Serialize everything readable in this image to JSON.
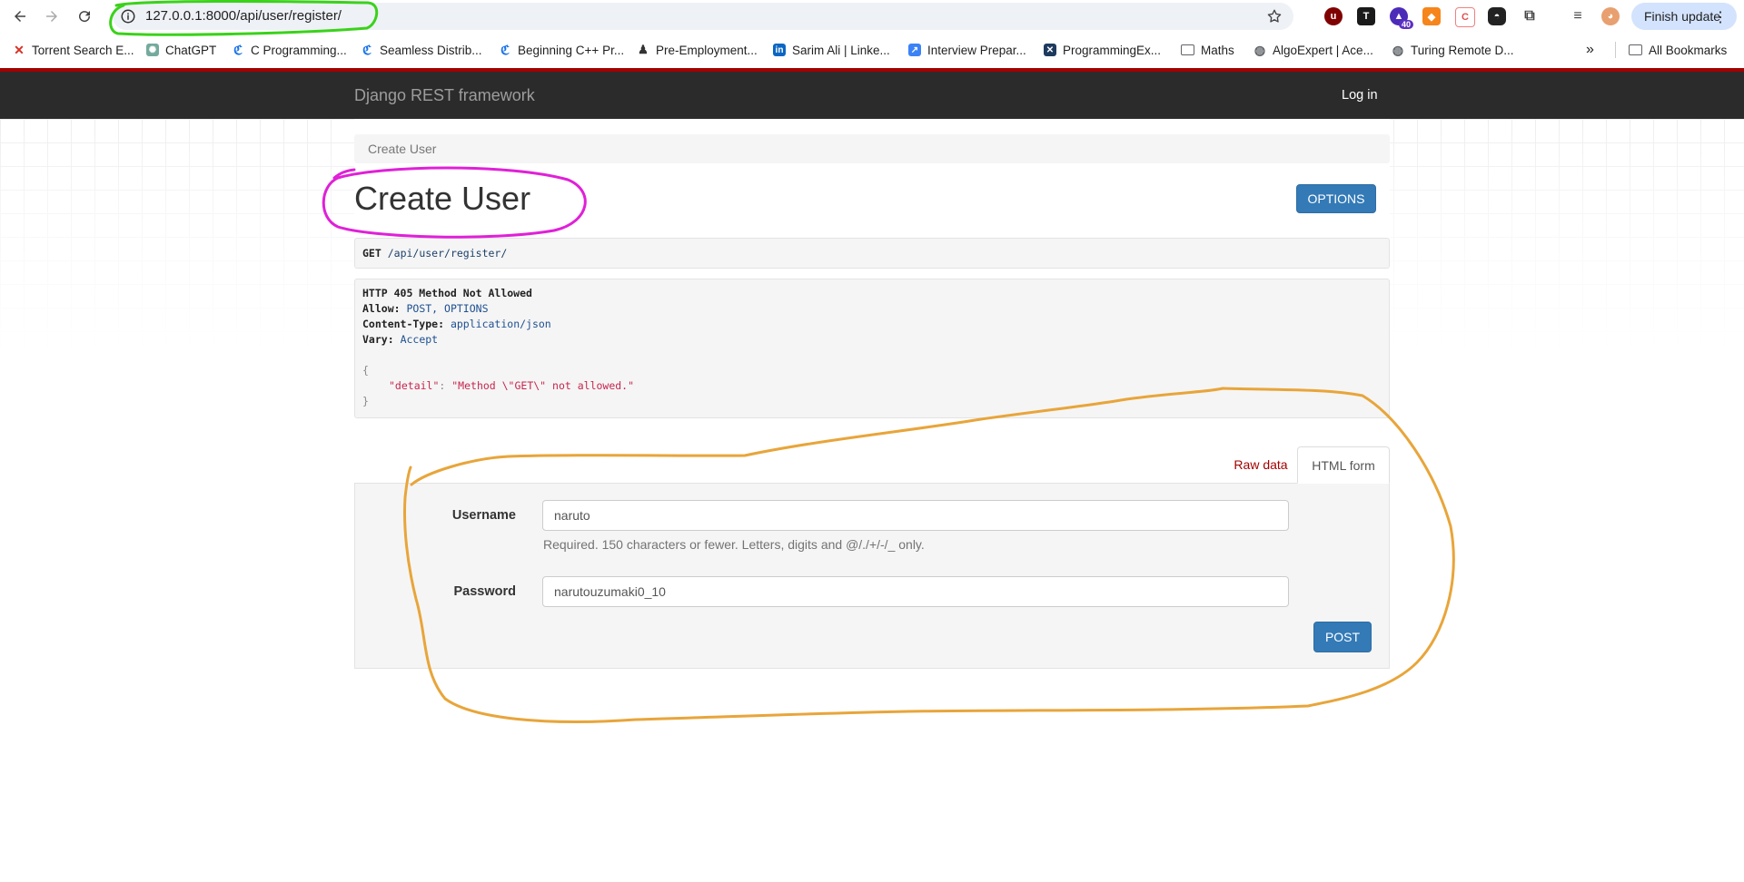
{
  "browser": {
    "url": "127.0.0.1:8000/api/user/register/",
    "update_label": "Finish update",
    "extension_badge": "40"
  },
  "bookmarks": [
    {
      "label": "Torrent Search E...",
      "color": "#d93025"
    },
    {
      "label": "ChatGPT",
      "color": "#74aa9c"
    },
    {
      "label": "C Programming...",
      "color": "#1a73e8"
    },
    {
      "label": "Seamless Distrib...",
      "color": "#1a73e8"
    },
    {
      "label": "Beginning C++ Pr...",
      "color": "#1a73e8"
    },
    {
      "label": "Pre-Employment...",
      "color": "#333333"
    },
    {
      "label": "Sarim Ali | Linke...",
      "color": "#0a66c2"
    },
    {
      "label": "Interview Prepar...",
      "color": "#3b82f6"
    },
    {
      "label": "ProgrammingEx...",
      "color": "#1e3a5f"
    },
    {
      "label": "Maths",
      "color": "#5f6368"
    },
    {
      "label": "AlgoExpert | Ace...",
      "color": "#5f6368"
    },
    {
      "label": "Turing Remote D...",
      "color": "#5f6368"
    }
  ],
  "all_bookmarks_label": "All Bookmarks",
  "navbar": {
    "brand": "Django REST framework",
    "login": "Log in"
  },
  "breadcrumb": "Create User",
  "page_title": "Create User",
  "options_button": "OPTIONS",
  "request": {
    "method": "GET",
    "path": "/api/user/register/"
  },
  "response": {
    "status": "HTTP 405 Method Not Allowed",
    "allow_key": "Allow:",
    "allow_value": "POST, OPTIONS",
    "content_type_key": "Content-Type:",
    "content_type_value": "application/json",
    "vary_key": "Vary:",
    "vary_value": "Accept",
    "open_brace": "{",
    "detail_key": "\"detail\"",
    "detail_value": "\"Method \\\"GET\\\" not allowed.\"",
    "close_brace": "}"
  },
  "tabs": {
    "raw": "Raw data",
    "html": "HTML form"
  },
  "form": {
    "username_label": "Username",
    "username_value": "naruto",
    "username_help": "Required. 150 characters or fewer. Letters, digits and @/./+/-/_ only.",
    "password_label": "Password",
    "password_value": "narutouzumaki0_10",
    "post_button": "POST"
  },
  "colors": {
    "annotation_url": "#3ad21a",
    "annotation_title": "#e020d8",
    "annotation_form": "#e8a53a",
    "drf_red": "#a30000",
    "button_blue": "#337ab7"
  }
}
